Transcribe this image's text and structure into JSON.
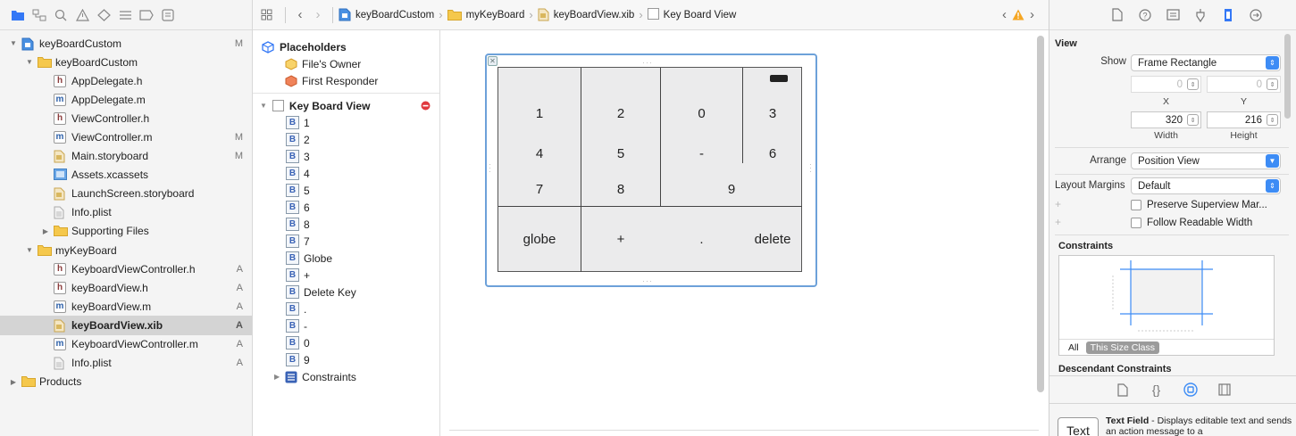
{
  "navigator": {
    "toolbar_icons": [
      "folder-icon",
      "source-control-icon",
      "search-icon",
      "warning-icon",
      "breakpoint-icon",
      "tests-icon",
      "debug-icon",
      "report-icon"
    ],
    "tree": [
      {
        "label": "keyBoardCustom",
        "status": "M",
        "icon": "project",
        "level": 0,
        "disclosure": "open"
      },
      {
        "label": "keyBoardCustom",
        "status": "",
        "icon": "folder",
        "level": 1,
        "disclosure": "open"
      },
      {
        "label": "AppDelegate.h",
        "status": "",
        "icon": "h",
        "level": 2,
        "disclosure": ""
      },
      {
        "label": "AppDelegate.m",
        "status": "",
        "icon": "m",
        "level": 2,
        "disclosure": ""
      },
      {
        "label": "ViewController.h",
        "status": "",
        "icon": "h",
        "level": 2,
        "disclosure": ""
      },
      {
        "label": "ViewController.m",
        "status": "M",
        "icon": "m",
        "level": 2,
        "disclosure": ""
      },
      {
        "label": "Main.storyboard",
        "status": "M",
        "icon": "storyboard",
        "level": 2,
        "disclosure": ""
      },
      {
        "label": "Assets.xcassets",
        "status": "",
        "icon": "assets",
        "level": 2,
        "disclosure": ""
      },
      {
        "label": "LaunchScreen.storyboard",
        "status": "",
        "icon": "storyboard",
        "level": 2,
        "disclosure": ""
      },
      {
        "label": "Info.plist",
        "status": "",
        "icon": "plist",
        "level": 2,
        "disclosure": ""
      },
      {
        "label": "Supporting Files",
        "status": "",
        "icon": "folder",
        "level": 2,
        "disclosure": "closed"
      },
      {
        "label": "myKeyBoard",
        "status": "",
        "icon": "folder",
        "level": 1,
        "disclosure": "open"
      },
      {
        "label": "KeyboardViewController.h",
        "status": "A",
        "icon": "h",
        "level": 2,
        "disclosure": ""
      },
      {
        "label": "keyBoardView.h",
        "status": "A",
        "icon": "h",
        "level": 2,
        "disclosure": ""
      },
      {
        "label": "keyBoardView.m",
        "status": "A",
        "icon": "m",
        "level": 2,
        "disclosure": ""
      },
      {
        "label": "keyBoardView.xib",
        "status": "A",
        "icon": "xib",
        "level": 2,
        "disclosure": "",
        "selected": true
      },
      {
        "label": "KeyboardViewController.m",
        "status": "A",
        "icon": "m",
        "level": 2,
        "disclosure": ""
      },
      {
        "label": "Info.plist",
        "status": "A",
        "icon": "plist",
        "level": 2,
        "disclosure": ""
      },
      {
        "label": "Products",
        "status": "",
        "icon": "folder",
        "level": 0,
        "disclosure": "closed"
      }
    ]
  },
  "jumpbar": {
    "crumbs": [
      {
        "label": "keyBoardCustom",
        "icon": "project"
      },
      {
        "label": "myKeyBoard",
        "icon": "folder"
      },
      {
        "label": "keyBoardView.xib",
        "icon": "xib"
      },
      {
        "label": "Key Board View",
        "icon": "view"
      }
    ],
    "warning_color": "#f5a623"
  },
  "outline": {
    "placeholders_title": "Placeholders",
    "files_owner": "File's Owner",
    "first_responder": "First Responder",
    "root_view": "Key Board View",
    "error_color": "#e0393e",
    "buttons": [
      "1",
      "2",
      "3",
      "4",
      "5",
      "6",
      "8",
      "7",
      "Globe",
      "+",
      "Delete Key",
      ".",
      "-",
      "0",
      "9"
    ],
    "constraints": "Constraints"
  },
  "keyboard": {
    "keys": [
      "1",
      "2",
      "0",
      "3",
      "4",
      "5",
      "-",
      "6",
      "7",
      "8",
      "9",
      "globe",
      "+",
      ".",
      "delete"
    ]
  },
  "inspector": {
    "section_title": "View",
    "show_label": "Show",
    "show_value": "Frame Rectangle",
    "x_value": "0",
    "y_value": "0",
    "x_label": "X",
    "y_label": "Y",
    "width_value": "320",
    "height_value": "216",
    "width_label": "Width",
    "height_label": "Height",
    "arrange_label": "Arrange",
    "arrange_value": "Position View",
    "margins_label": "Layout Margins",
    "margins_value": "Default",
    "preserve_label": "Preserve Superview Mar...",
    "readable_label": "Follow Readable Width",
    "constraints_title": "Constraints",
    "all_label": "All",
    "size_class_label": "This Size Class",
    "descendant_title": "Descendant Constraints",
    "library_item_badge": "Text",
    "library_item_title": "Text Field",
    "library_item_desc": " - Displays editable text and sends an action message to a",
    "accent": "#3d8cf5"
  }
}
